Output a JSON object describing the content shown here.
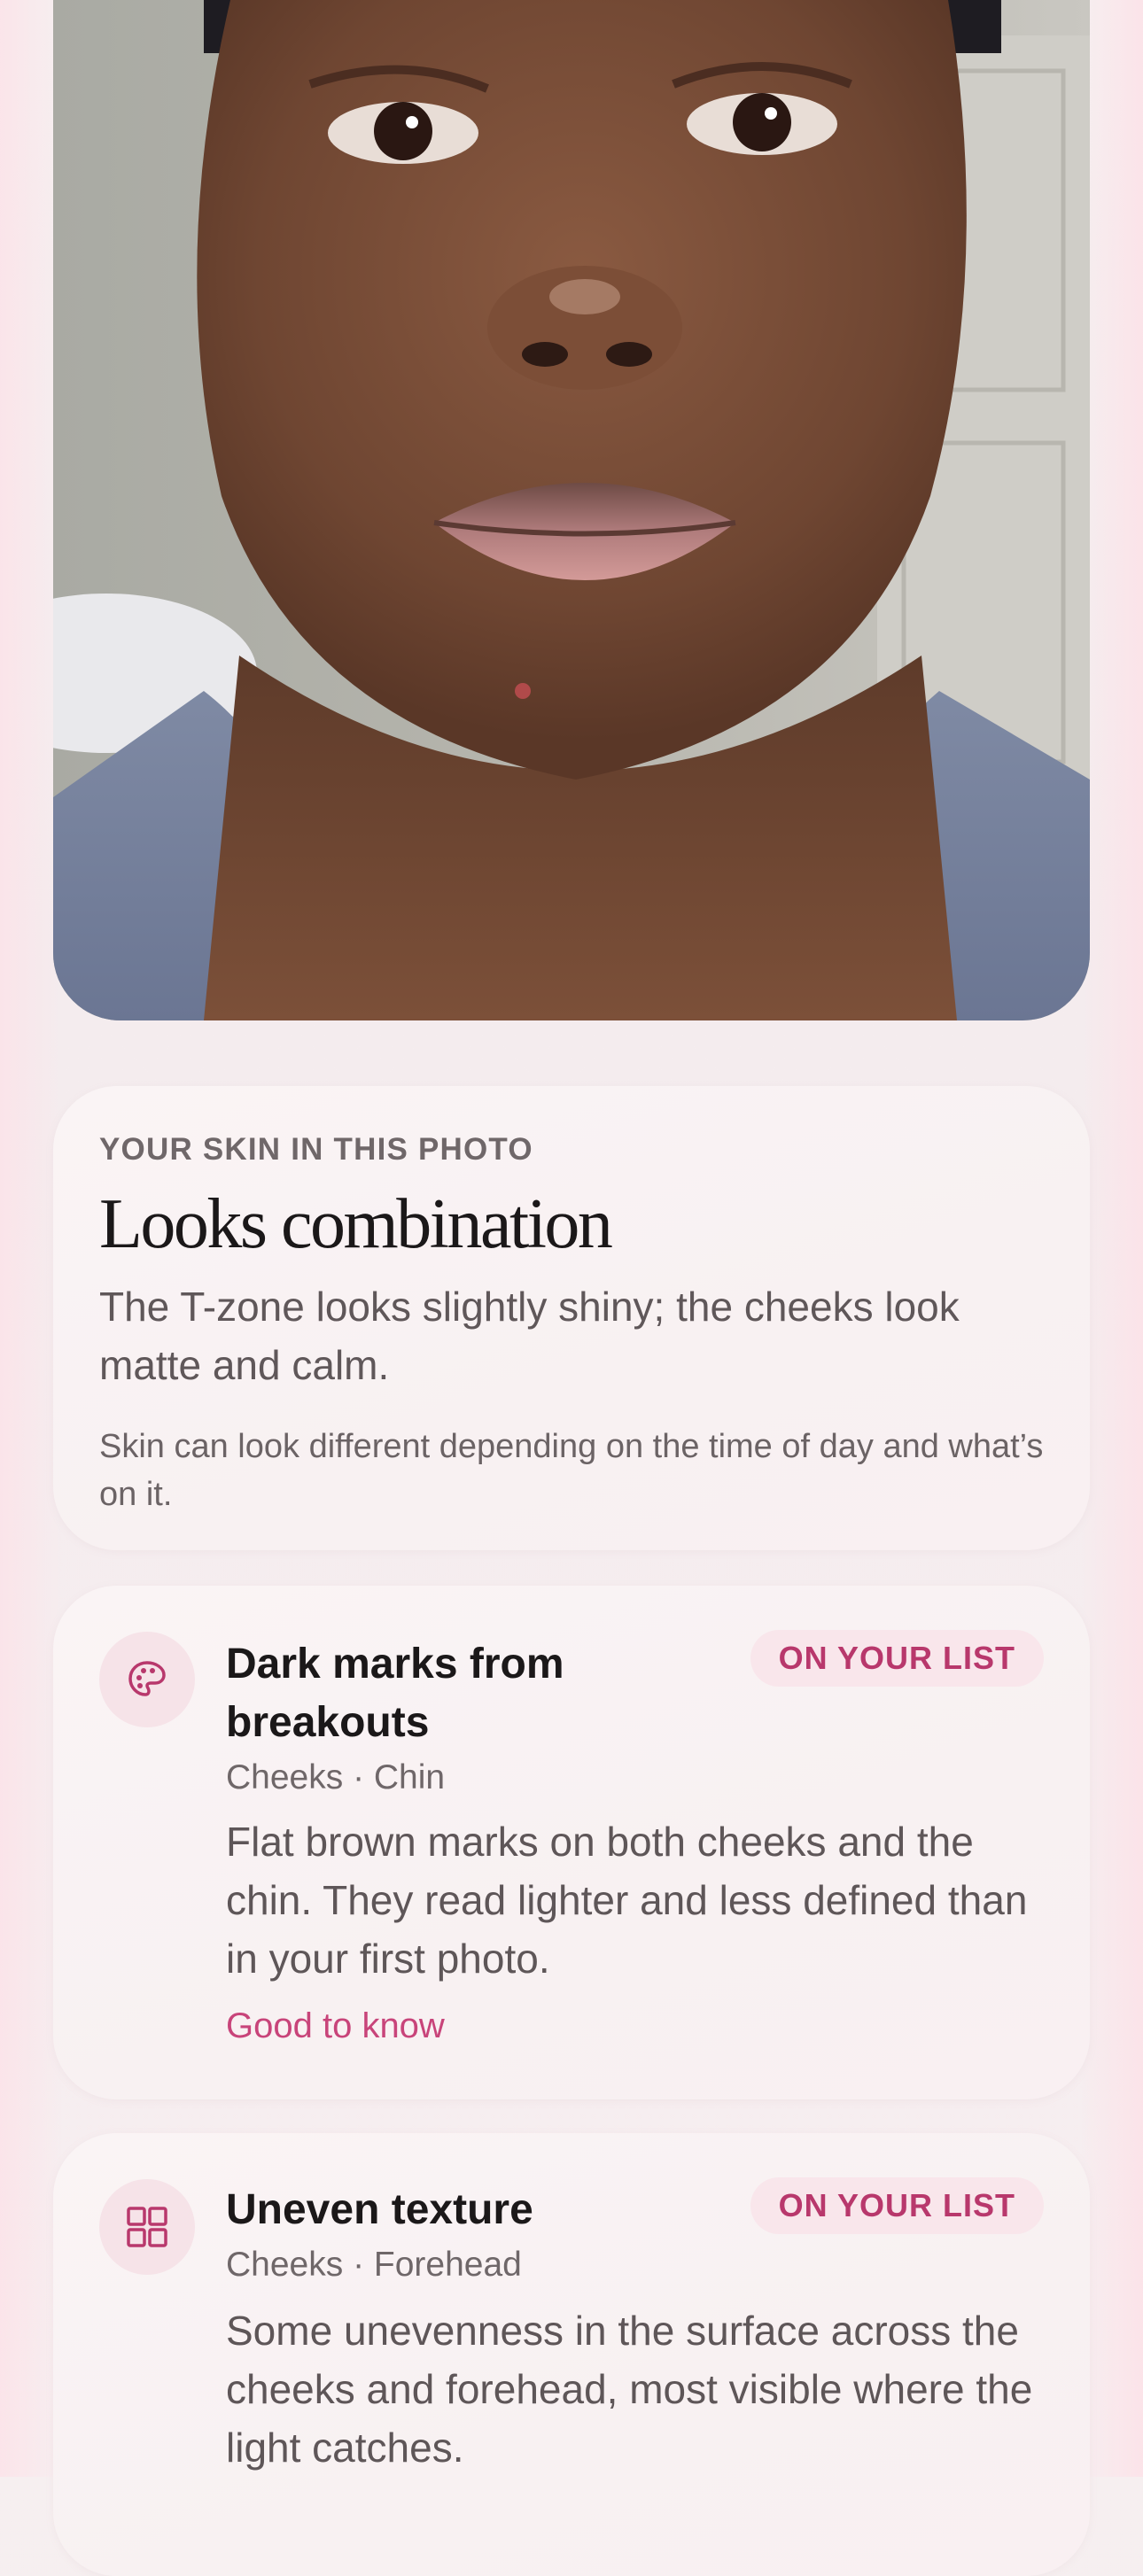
{
  "photo": {
    "alt_icon": "face-photo"
  },
  "summary": {
    "eyebrow": "YOUR SKIN IN THIS PHOTO",
    "headline": "Looks combination",
    "body": "The T-zone looks slightly shiny; the cheeks look matte and calm.",
    "note": "Skin can look different depending on the time of day and what’s on it."
  },
  "findings": [
    {
      "icon": "palette-icon",
      "title": "Dark marks from breakouts",
      "badge": "ON YOUR LIST",
      "areas": "Cheeks · Chin",
      "description": "Flat brown marks on both cheeks and the chin. They read lighter and less defined than in your first photo.",
      "link": "Good to know"
    },
    {
      "icon": "grid-icon",
      "title": "Uneven texture",
      "badge": "ON YOUR LIST",
      "areas": "Cheeks · Forehead",
      "description": "Some unevenness in the surface across the cheeks and forehead, most visible where the light catches."
    }
  ],
  "colors": {
    "accent": "#c8447a",
    "badge_bg": "#f9e6eb",
    "card_bg": "#faf4f5",
    "icon_bg": "#f6e3e8"
  }
}
